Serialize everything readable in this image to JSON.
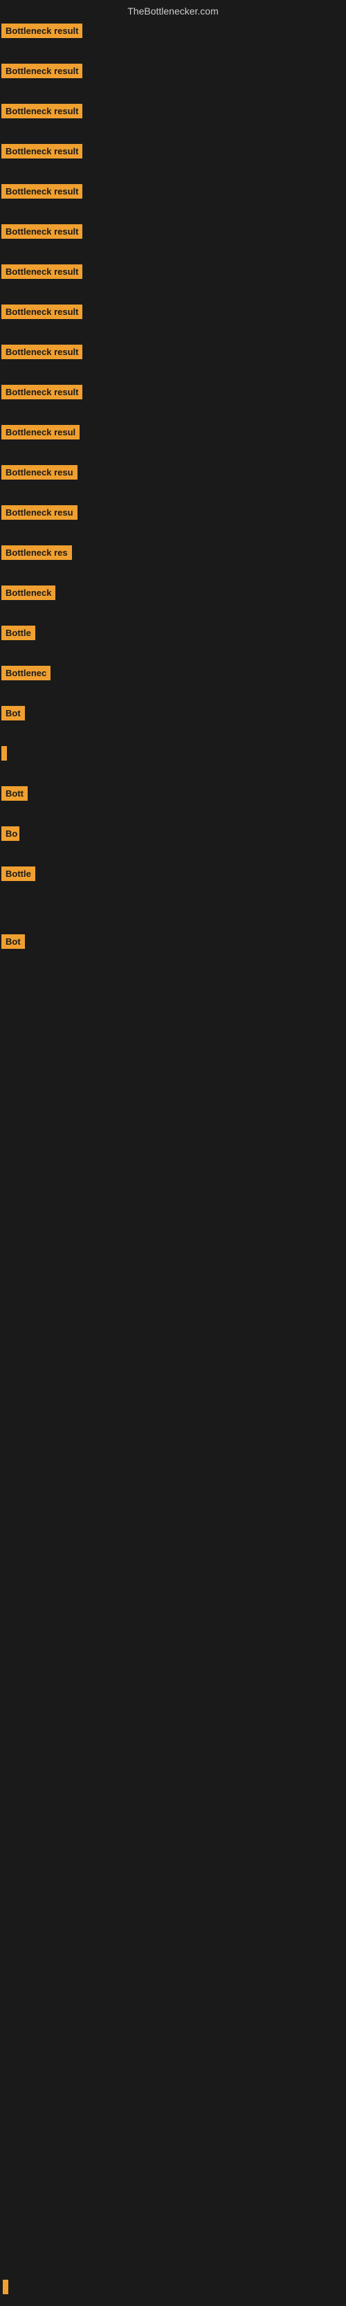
{
  "site": {
    "title": "TheBottlenecker.com"
  },
  "items": [
    {
      "id": 1,
      "label": "Bottleneck result",
      "width": "full",
      "top_space": 0
    },
    {
      "id": 2,
      "label": "Bottleneck result",
      "width": "full",
      "top_space": 20
    },
    {
      "id": 3,
      "label": "Bottleneck result",
      "width": "full",
      "top_space": 20
    },
    {
      "id": 4,
      "label": "Bottleneck result",
      "width": "full",
      "top_space": 20
    },
    {
      "id": 5,
      "label": "Bottleneck result",
      "width": "full",
      "top_space": 20
    },
    {
      "id": 6,
      "label": "Bottleneck result",
      "width": "full",
      "top_space": 20
    },
    {
      "id": 7,
      "label": "Bottleneck result",
      "width": "full",
      "top_space": 20
    },
    {
      "id": 8,
      "label": "Bottleneck result",
      "width": "full",
      "top_space": 20
    },
    {
      "id": 9,
      "label": "Bottleneck result",
      "width": "full",
      "top_space": 20
    },
    {
      "id": 10,
      "label": "Bottleneck result",
      "width": "full",
      "top_space": 20
    },
    {
      "id": 11,
      "label": "Bottleneck resul",
      "width": "partial1",
      "top_space": 20
    },
    {
      "id": 12,
      "label": "Bottleneck resu",
      "width": "partial2",
      "top_space": 20
    },
    {
      "id": 13,
      "label": "Bottleneck resu",
      "width": "partial2",
      "top_space": 20
    },
    {
      "id": 14,
      "label": "Bottleneck res",
      "width": "partial3",
      "top_space": 20
    },
    {
      "id": 15,
      "label": "Bottleneck",
      "width": "partial4",
      "top_space": 20
    },
    {
      "id": 16,
      "label": "Bottle",
      "width": "partial5",
      "top_space": 20
    },
    {
      "id": 17,
      "label": "Bottlenec",
      "width": "partial6",
      "top_space": 20
    },
    {
      "id": 18,
      "label": "Bot",
      "width": "partial7",
      "top_space": 20
    },
    {
      "id": 19,
      "label": "",
      "width": "tiny",
      "top_space": 20
    },
    {
      "id": 20,
      "label": "Bott",
      "width": "partial8",
      "top_space": 20
    },
    {
      "id": 21,
      "label": "Bo",
      "width": "partial9",
      "top_space": 20
    },
    {
      "id": 22,
      "label": "Bottle",
      "width": "partial5",
      "top_space": 20
    },
    {
      "id": 23,
      "label": "Bot",
      "width": "partial7",
      "top_space": 60
    },
    {
      "id": 24,
      "label": "",
      "width": "cursor",
      "top_space": 3200
    }
  ],
  "colors": {
    "badge_bg": "#f0a030",
    "badge_text": "#1a1a1a",
    "body_bg": "#1a1a1a",
    "site_title": "#cccccc"
  }
}
